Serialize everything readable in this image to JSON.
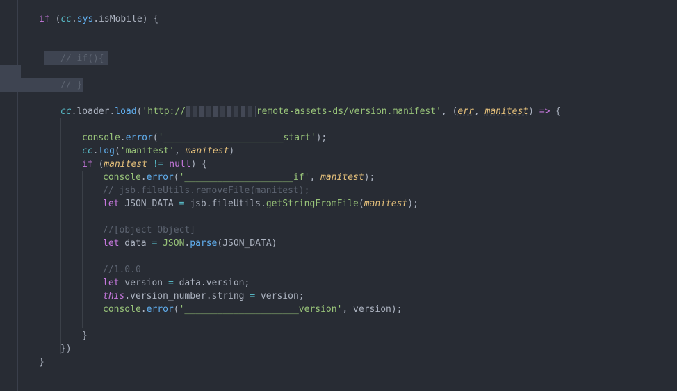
{
  "editor": {
    "lines": {
      "l1": {
        "kw": "if",
        "p1": " (",
        "obj": "cc",
        "d1": ".",
        "sys": "sys",
        "d2": ".",
        "prop": "isMobile",
        "p2": ") {"
      },
      "l2": {
        "cm": "// if(){"
      },
      "l3": {
        "cm": "// }"
      },
      "l4": {
        "obj": "cc",
        "d1": ".",
        "loader": "loader",
        "d2": ".",
        "fn": "load",
        "p1": "(",
        "q1": "'",
        "url1": "http://",
        "url2": "remote-assets-ds/version.manifest",
        "q2": "'",
        "p2": ", (",
        "err": "err",
        "comma": ", ",
        "mani": "manitest",
        "p3": ") ",
        "arrow": "=>",
        "p4": " {"
      },
      "l5": {
        "obj": "console",
        "d": ".",
        "fn": "error",
        "p1": "(",
        "str": "'______________________start'",
        "p2": ");"
      },
      "l6": {
        "obj": "cc",
        "d": ".",
        "fn": "log",
        "p1": "(",
        "str": "'manitest'",
        "c": ", ",
        "param": "manitest",
        "p2": ")"
      },
      "l7": {
        "kw": "if",
        "p1": " (",
        "param": "manitest",
        "op": " != ",
        "kw2": "null",
        "p2": ") {"
      },
      "l8": {
        "obj": "console",
        "d": ".",
        "fn": "error",
        "p1": "(",
        "str": "'____________________if'",
        "c": ", ",
        "param": "manitest",
        "p2": ");"
      },
      "l9": {
        "cm": "// jsb.fileUtils.removeFile(manitest);"
      },
      "l10": {
        "kw": "let",
        "v": " JSON_DATA ",
        "op": "=",
        "a": " jsb",
        "d1": ".",
        "b": "fileUtils",
        "d2": ".",
        "fn": "getStringFromFile",
        "p1": "(",
        "param": "manitest",
        "p2": ");"
      },
      "l11": {
        "cm": "//[object Object]"
      },
      "l12": {
        "kw": "let",
        "v": " data ",
        "op": "=",
        "sp": " ",
        "obj": "JSON",
        "d": ".",
        "fn": "parse",
        "p": "(JSON_DATA)"
      },
      "l13": {
        "cm": "//1.0.0"
      },
      "l14": {
        "kw": "let",
        "v": " version ",
        "op": "=",
        "rest": " data.version;"
      },
      "l15": {
        "this": "this",
        "rest1": ".version_number.string ",
        "op": "=",
        "rest2": " version;"
      },
      "l16": {
        "obj": "console",
        "d": ".",
        "fn": "error",
        "p1": "(",
        "str": "'_____________________version'",
        "rest": ", version);"
      },
      "l17": {
        "p": "}"
      },
      "l18": {
        "p": "})"
      },
      "l19": {
        "p": "}"
      }
    }
  }
}
